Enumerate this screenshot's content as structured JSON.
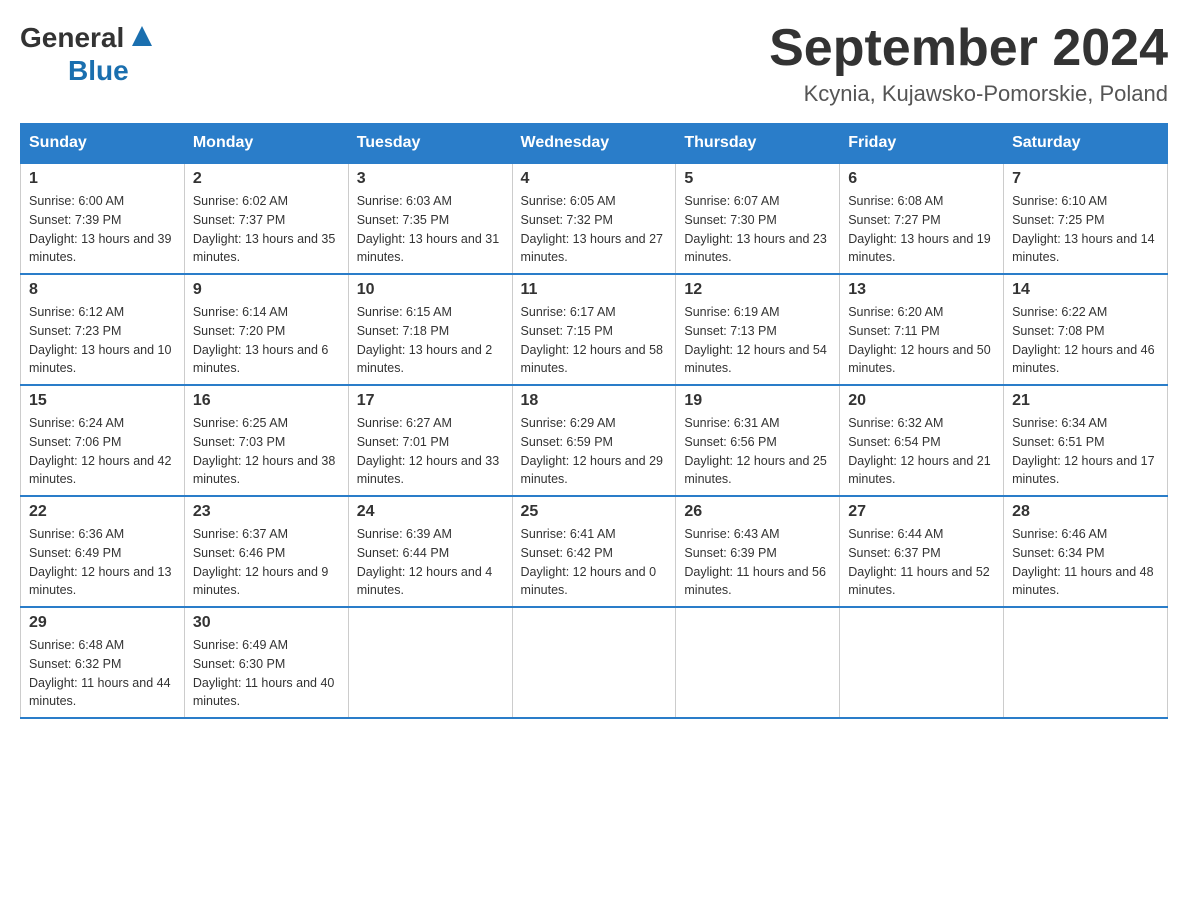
{
  "logo": {
    "general": "General",
    "blue": "Blue"
  },
  "title": "September 2024",
  "location": "Kcynia, Kujawsko-Pomorskie, Poland",
  "weekdays": [
    "Sunday",
    "Monday",
    "Tuesday",
    "Wednesday",
    "Thursday",
    "Friday",
    "Saturday"
  ],
  "weeks": [
    [
      {
        "day": "1",
        "sunrise": "6:00 AM",
        "sunset": "7:39 PM",
        "daylight": "13 hours and 39 minutes."
      },
      {
        "day": "2",
        "sunrise": "6:02 AM",
        "sunset": "7:37 PM",
        "daylight": "13 hours and 35 minutes."
      },
      {
        "day": "3",
        "sunrise": "6:03 AM",
        "sunset": "7:35 PM",
        "daylight": "13 hours and 31 minutes."
      },
      {
        "day": "4",
        "sunrise": "6:05 AM",
        "sunset": "7:32 PM",
        "daylight": "13 hours and 27 minutes."
      },
      {
        "day": "5",
        "sunrise": "6:07 AM",
        "sunset": "7:30 PM",
        "daylight": "13 hours and 23 minutes."
      },
      {
        "day": "6",
        "sunrise": "6:08 AM",
        "sunset": "7:27 PM",
        "daylight": "13 hours and 19 minutes."
      },
      {
        "day": "7",
        "sunrise": "6:10 AM",
        "sunset": "7:25 PM",
        "daylight": "13 hours and 14 minutes."
      }
    ],
    [
      {
        "day": "8",
        "sunrise": "6:12 AM",
        "sunset": "7:23 PM",
        "daylight": "13 hours and 10 minutes."
      },
      {
        "day": "9",
        "sunrise": "6:14 AM",
        "sunset": "7:20 PM",
        "daylight": "13 hours and 6 minutes."
      },
      {
        "day": "10",
        "sunrise": "6:15 AM",
        "sunset": "7:18 PM",
        "daylight": "13 hours and 2 minutes."
      },
      {
        "day": "11",
        "sunrise": "6:17 AM",
        "sunset": "7:15 PM",
        "daylight": "12 hours and 58 minutes."
      },
      {
        "day": "12",
        "sunrise": "6:19 AM",
        "sunset": "7:13 PM",
        "daylight": "12 hours and 54 minutes."
      },
      {
        "day": "13",
        "sunrise": "6:20 AM",
        "sunset": "7:11 PM",
        "daylight": "12 hours and 50 minutes."
      },
      {
        "day": "14",
        "sunrise": "6:22 AM",
        "sunset": "7:08 PM",
        "daylight": "12 hours and 46 minutes."
      }
    ],
    [
      {
        "day": "15",
        "sunrise": "6:24 AM",
        "sunset": "7:06 PM",
        "daylight": "12 hours and 42 minutes."
      },
      {
        "day": "16",
        "sunrise": "6:25 AM",
        "sunset": "7:03 PM",
        "daylight": "12 hours and 38 minutes."
      },
      {
        "day": "17",
        "sunrise": "6:27 AM",
        "sunset": "7:01 PM",
        "daylight": "12 hours and 33 minutes."
      },
      {
        "day": "18",
        "sunrise": "6:29 AM",
        "sunset": "6:59 PM",
        "daylight": "12 hours and 29 minutes."
      },
      {
        "day": "19",
        "sunrise": "6:31 AM",
        "sunset": "6:56 PM",
        "daylight": "12 hours and 25 minutes."
      },
      {
        "day": "20",
        "sunrise": "6:32 AM",
        "sunset": "6:54 PM",
        "daylight": "12 hours and 21 minutes."
      },
      {
        "day": "21",
        "sunrise": "6:34 AM",
        "sunset": "6:51 PM",
        "daylight": "12 hours and 17 minutes."
      }
    ],
    [
      {
        "day": "22",
        "sunrise": "6:36 AM",
        "sunset": "6:49 PM",
        "daylight": "12 hours and 13 minutes."
      },
      {
        "day": "23",
        "sunrise": "6:37 AM",
        "sunset": "6:46 PM",
        "daylight": "12 hours and 9 minutes."
      },
      {
        "day": "24",
        "sunrise": "6:39 AM",
        "sunset": "6:44 PM",
        "daylight": "12 hours and 4 minutes."
      },
      {
        "day": "25",
        "sunrise": "6:41 AM",
        "sunset": "6:42 PM",
        "daylight": "12 hours and 0 minutes."
      },
      {
        "day": "26",
        "sunrise": "6:43 AM",
        "sunset": "6:39 PM",
        "daylight": "11 hours and 56 minutes."
      },
      {
        "day": "27",
        "sunrise": "6:44 AM",
        "sunset": "6:37 PM",
        "daylight": "11 hours and 52 minutes."
      },
      {
        "day": "28",
        "sunrise": "6:46 AM",
        "sunset": "6:34 PM",
        "daylight": "11 hours and 48 minutes."
      }
    ],
    [
      {
        "day": "29",
        "sunrise": "6:48 AM",
        "sunset": "6:32 PM",
        "daylight": "11 hours and 44 minutes."
      },
      {
        "day": "30",
        "sunrise": "6:49 AM",
        "sunset": "6:30 PM",
        "daylight": "11 hours and 40 minutes."
      },
      null,
      null,
      null,
      null,
      null
    ]
  ]
}
